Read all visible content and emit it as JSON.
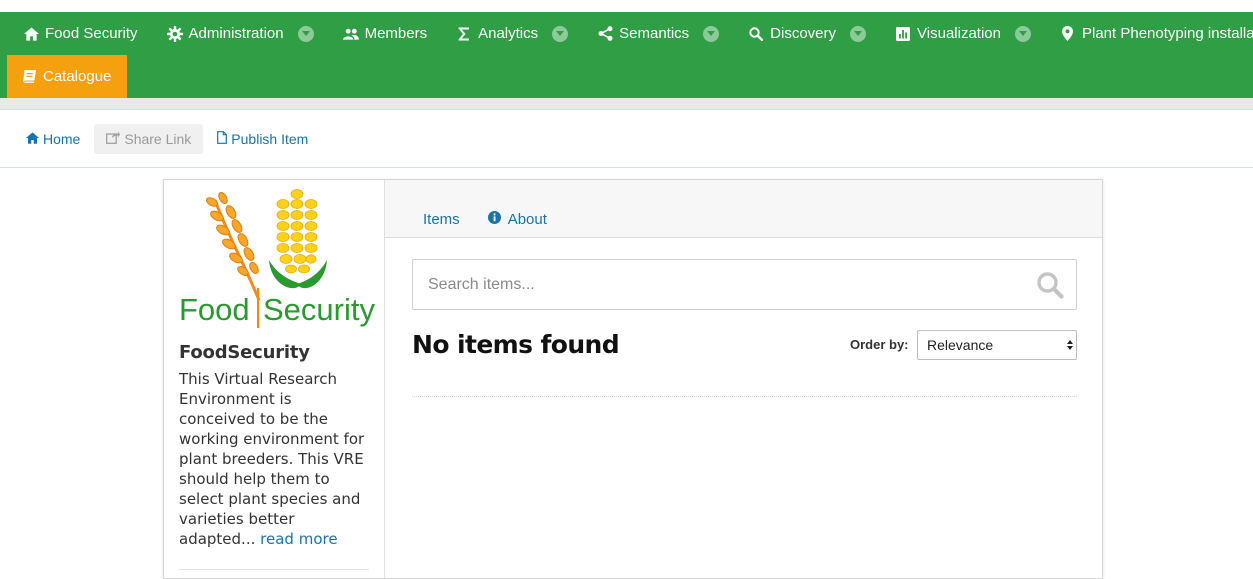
{
  "nav": {
    "items": [
      {
        "label": "Food Security",
        "icon": "home-icon",
        "dropdown": false
      },
      {
        "label": "Administration",
        "icon": "gear-icon",
        "dropdown": true
      },
      {
        "label": "Members",
        "icon": "users-icon",
        "dropdown": false
      },
      {
        "label": "Analytics",
        "icon": "sigma-icon",
        "dropdown": true
      },
      {
        "label": "Semantics",
        "icon": "share-icon",
        "dropdown": true
      },
      {
        "label": "Discovery",
        "icon": "search-icon",
        "dropdown": true
      },
      {
        "label": "Visualization",
        "icon": "chart-icon",
        "dropdown": true
      },
      {
        "label": "Plant Phenotyping installations",
        "icon": "map-pin-icon",
        "dropdown": false
      }
    ],
    "active": {
      "label": "Catalogue",
      "icon": "book-icon"
    },
    "colors": {
      "bar": "#2f9e45",
      "active": "#f5a00f"
    }
  },
  "breadcrumb": {
    "home": "Home",
    "share": "Share Link",
    "publish": "Publish Item"
  },
  "org": {
    "logo_text_1": "Food",
    "logo_text_2": "Security",
    "title": "FoodSecurity",
    "description": "This Virtual Research Environment is conceived to be the working environment for plant breeders. This VRE should help them to select plant species and varieties better adapted...",
    "read_more": "read more"
  },
  "tabs": {
    "items": "Items",
    "about": "About"
  },
  "search": {
    "placeholder": "Search items...",
    "value": ""
  },
  "results": {
    "title": "No items found",
    "order_label": "Order by:",
    "order_value": "Relevance"
  }
}
